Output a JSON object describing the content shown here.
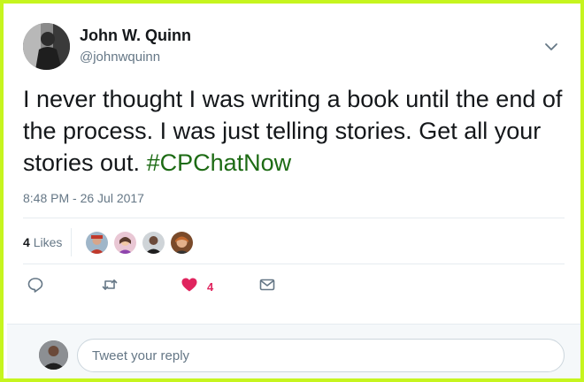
{
  "user": {
    "name": "John W. Quinn",
    "handle": "@johnwquinn"
  },
  "tweet": {
    "text": "I never thought I was writing a book until the end of the process. I was just telling stories. Get all your stories out.",
    "hashtag": "#CPChatNow",
    "timestamp": "8:48 PM - 26 Jul 2017"
  },
  "likes": {
    "count": "4",
    "label": "Likes",
    "avatars": [
      "liker-avatar-1",
      "liker-avatar-2",
      "liker-avatar-3",
      "liker-avatar-4"
    ]
  },
  "actions": {
    "reply_icon": "reply-icon",
    "retweet_icon": "retweet-icon",
    "like_icon": "heart-icon",
    "like_count": "4",
    "dm_icon": "envelope-icon"
  },
  "reply": {
    "placeholder": "Tweet your reply"
  },
  "colors": {
    "frame": "#c6f51e",
    "hashtag": "#1d6b14",
    "like": "#e0245e",
    "icon": "#657786"
  }
}
